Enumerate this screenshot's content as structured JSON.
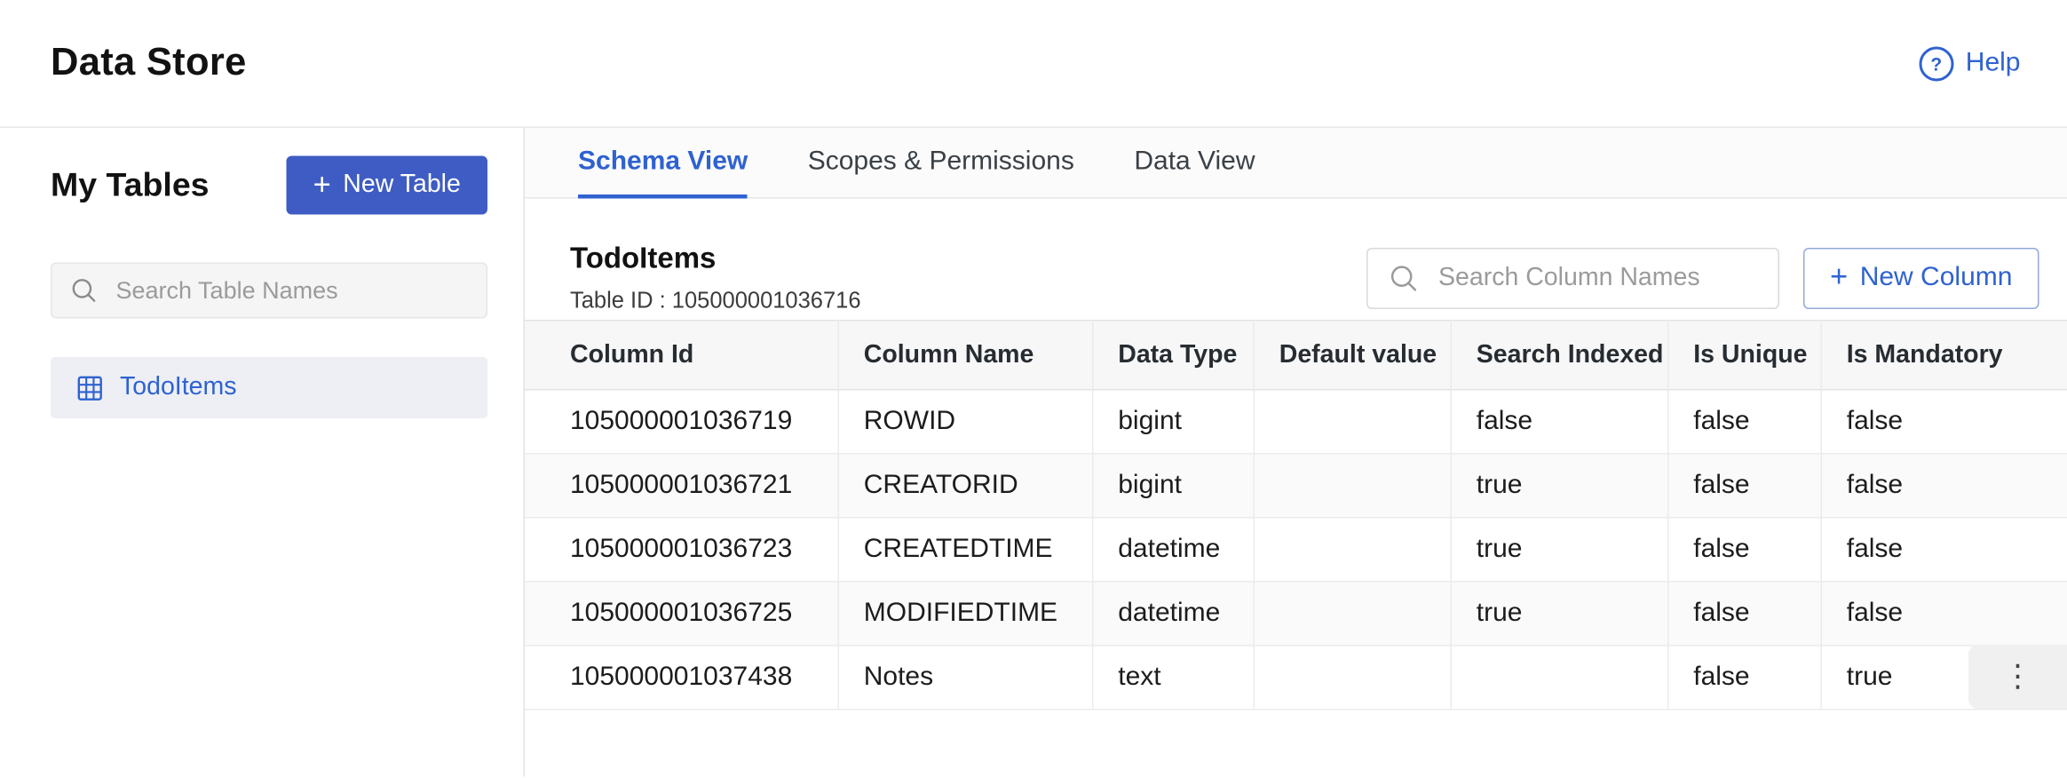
{
  "header": {
    "title": "Data Store",
    "help_label": "Help",
    "help_icon_glyph": "?"
  },
  "sidebar": {
    "title": "My Tables",
    "new_table_label": "New Table",
    "plus_glyph": "+",
    "search_placeholder": "Search Table Names",
    "tables": [
      {
        "name": "TodoItems",
        "selected": true
      }
    ]
  },
  "main": {
    "tabs": [
      {
        "label": "Schema View",
        "active": true
      },
      {
        "label": "Scopes & Permissions",
        "active": false
      },
      {
        "label": "Data View",
        "active": false
      }
    ],
    "table_title": "TodoItems",
    "table_id_label": "Table ID : 105000001036716",
    "search_placeholder": "Search Column Names",
    "new_column_label": "New Column",
    "plus_glyph": "+",
    "columns": [
      "Column Id",
      "Column Name",
      "Data Type",
      "Default value",
      "Search Indexed",
      "Is Unique",
      "Is Mandatory"
    ],
    "rows": [
      [
        "105000001036719",
        "ROWID",
        "bigint",
        "",
        "false",
        "false",
        "false"
      ],
      [
        "105000001036721",
        "CREATORID",
        "bigint",
        "",
        "true",
        "false",
        "false"
      ],
      [
        "105000001036723",
        "CREATEDTIME",
        "datetime",
        "",
        "true",
        "false",
        "false"
      ],
      [
        "105000001036725",
        "MODIFIEDTIME",
        "datetime",
        "",
        "true",
        "false",
        "false"
      ],
      [
        "105000001037438",
        "Notes",
        "text",
        "",
        "",
        "false",
        "true"
      ]
    ],
    "row_actions_glyph": "⋮"
  },
  "icons": {
    "help-icon": "circled question mark",
    "search-icon": "magnifier",
    "plus-icon": "plus",
    "table-grid-icon": "3x3 grid",
    "kebab-icon": "vertical three dots"
  },
  "colors": {
    "accent_blue": "#2f62d0",
    "button_blue": "#3e5cc3",
    "selected_item_bg": "#edeff4",
    "table_header_bg": "#f7f7f8",
    "stripe_bg": "#fafafa",
    "border": "#e8e8e8",
    "text_dark": "#121212"
  }
}
